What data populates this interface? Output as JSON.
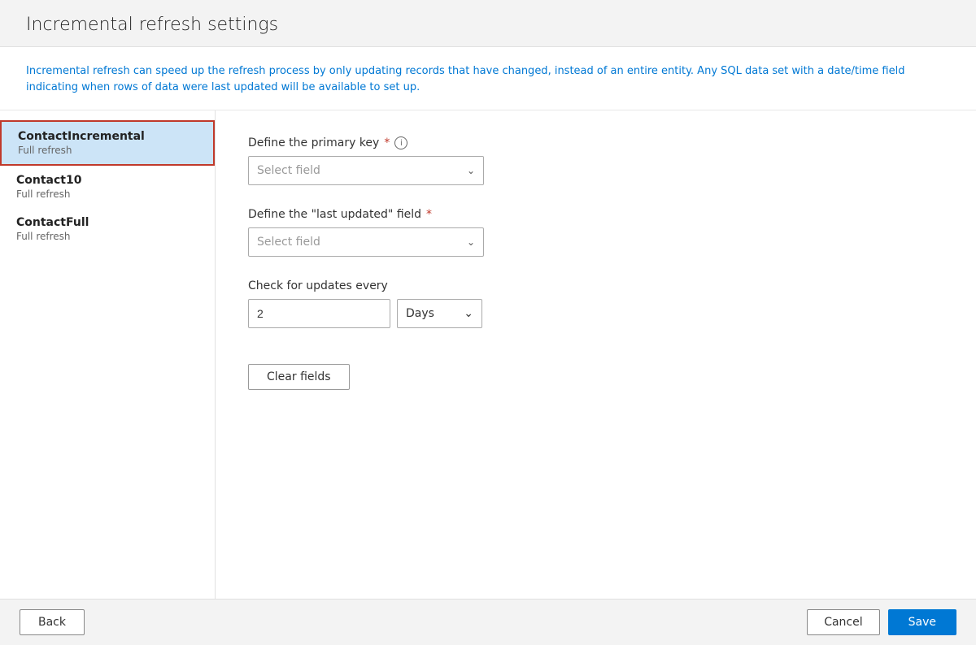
{
  "header": {
    "title": "Incremental refresh settings"
  },
  "info_bar": {
    "text": "Incremental refresh can speed up the refresh process by only updating records that have changed, instead of an entire entity. Any SQL data set with a date/time field indicating when rows of data were last updated will be available to set up."
  },
  "sidebar": {
    "items": [
      {
        "id": "contact-incremental",
        "name": "ContactIncremental",
        "sub": "Full refresh",
        "active": true
      },
      {
        "id": "contact10",
        "name": "Contact10",
        "sub": "Full refresh",
        "active": false
      },
      {
        "id": "contact-full",
        "name": "ContactFull",
        "sub": "Full refresh",
        "active": false
      }
    ]
  },
  "form": {
    "primary_key": {
      "label": "Define the primary key",
      "required": true,
      "placeholder": "Select field"
    },
    "last_updated": {
      "label": "Define the \"last updated\" field",
      "required": true,
      "placeholder": "Select field"
    },
    "check_updates": {
      "label": "Check for updates every",
      "value": "2",
      "unit": "Days"
    },
    "clear_button": "Clear fields"
  },
  "footer": {
    "back_label": "Back",
    "cancel_label": "Cancel",
    "save_label": "Save"
  },
  "icons": {
    "chevron_down": "⌄",
    "info": "i"
  }
}
